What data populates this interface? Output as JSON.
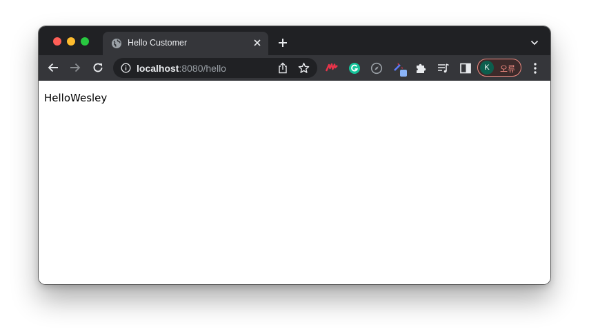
{
  "window": {
    "traffic_lights": [
      "close",
      "minimize",
      "maximize"
    ]
  },
  "tab": {
    "title": "Hello Customer",
    "favicon": "globe-icon"
  },
  "toolbar": {
    "url_host": "localhost",
    "url_rest": ":8080/hello",
    "profile_initial": "K",
    "profile_label": "오류",
    "extensions": [
      "red-extension-icon",
      "grammarly-icon",
      "compass-icon",
      "color-picker-icon",
      "puzzle-icon",
      "reading-list-icon",
      "side-panel-icon"
    ]
  },
  "page": {
    "text": "HelloWesley"
  },
  "colors": {
    "tabstrip": "#202124",
    "toolbar": "#35363a",
    "profile_accent": "#f28b82",
    "avatar": "#0d5e4d"
  }
}
